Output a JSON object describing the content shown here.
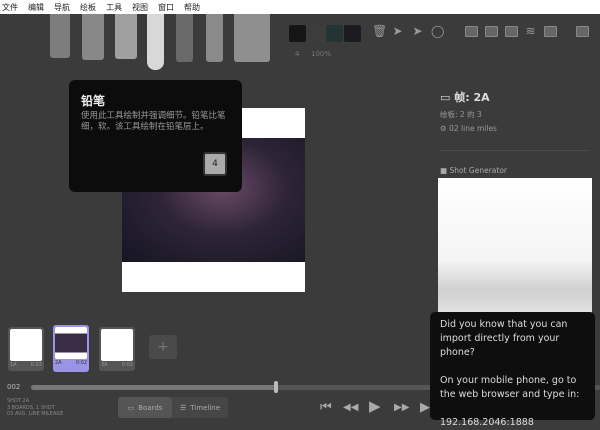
{
  "menu": [
    "文件",
    "编辑",
    "导航",
    "绘板",
    "工具",
    "视图",
    "窗口",
    "帮助"
  ],
  "toolbar": {
    "brush_size": "4",
    "opacity": "100%",
    "swatch_colors": [
      "#151515",
      "#3c3c3c",
      "#243434",
      "#1a1c20"
    ]
  },
  "tooltip": {
    "title": "铅笔",
    "body": "使用此工具绘制并强调细节。铅笔比笔细，软。该工具绘制在铅笔层上。",
    "shortcut": "4"
  },
  "panel": {
    "frame_title": "帧: 2A",
    "board_count": "绘板: 2 的 3",
    "line_miles": "02 line miles",
    "shot_generator": "Shot Generator"
  },
  "thumbnails": [
    {
      "label": "1A",
      "time": "0:02"
    },
    {
      "label": "2A",
      "time": "0:02"
    },
    {
      "label": "3A",
      "time": "0:02"
    }
  ],
  "timeline": {
    "current": "002",
    "progress": 0.43
  },
  "stats": [
    "SHOT 2A",
    "3 BOARDS, 1 SHOT",
    "03 AVG. LINE MILEAGE"
  ],
  "view_buttons": {
    "boards": "Boards",
    "timeline": "Timeline"
  },
  "phone_tip": {
    "line1": "Did you know that you can import directly from your phone?",
    "line2": "On your mobile phone, go to the web browser and type in:",
    "address": "192.168.2046:1888"
  },
  "accent": "#9a93e6"
}
